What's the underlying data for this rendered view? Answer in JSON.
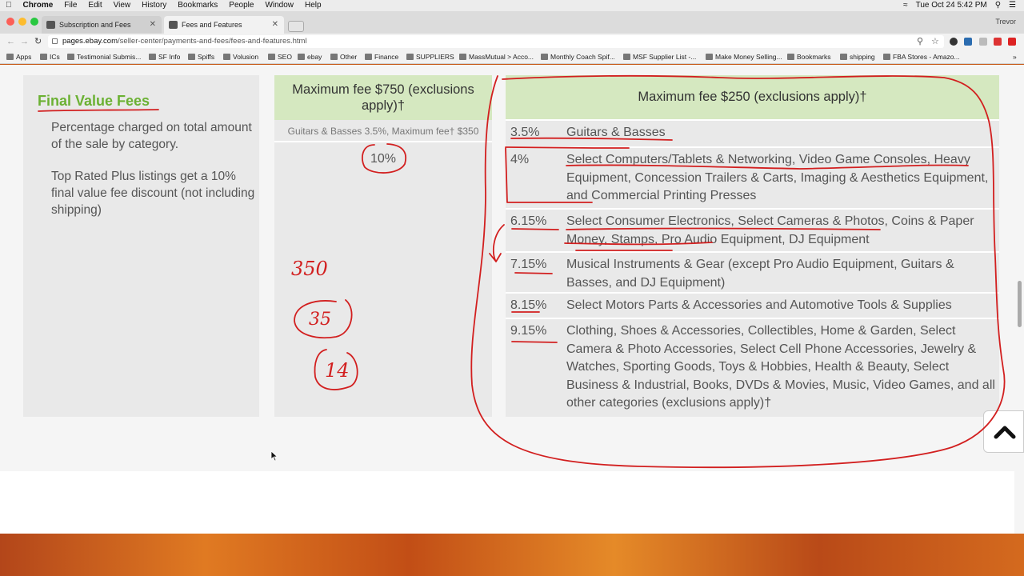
{
  "menubar": {
    "app": "Chrome",
    "items": [
      "File",
      "Edit",
      "View",
      "History",
      "Bookmarks",
      "People",
      "Window",
      "Help"
    ],
    "clock": "Tue Oct 24  5:42 PM"
  },
  "tabs": [
    {
      "title": "Subscription and Fees"
    },
    {
      "title": "Fees and Features"
    }
  ],
  "profile": "Trevor",
  "address": {
    "host": "pages.ebay.com",
    "path": "/seller-center/payments-and-fees/fees-and-features.html"
  },
  "bookmarks": [
    "Apps",
    "ICs",
    "Testimonial Submis...",
    "SF Info",
    "Spiffs",
    "Volusion",
    "SEO",
    "ebay",
    "Other",
    "Finance",
    "SUPPLIERS",
    "MassMutual > Acco...",
    "Monthly Coach Spif...",
    "MSF Supplier List -...",
    "Make Money Selling...",
    "Bookmarks",
    "shipping",
    "FBA Stores - Amazo..."
  ],
  "fees": {
    "title": "Final Value Fees",
    "desc1": "Percentage charged on total amount of the sale by category.",
    "desc2": "Top Rated Plus listings get a 10% final value fee discount (not including shipping)",
    "col2_header": "Maximum fee $750 (exclusions apply)†",
    "col2_sub": "Guitars & Basses 3.5%, Maximum fee† $350",
    "col2_pct": "10%",
    "col3_header": "Maximum fee $250 (exclusions apply)†",
    "rows": [
      {
        "rate": "3.5%",
        "desc": "Guitars & Basses"
      },
      {
        "rate": "4%",
        "desc": "Select Computers/Tablets & Networking, Video Game Consoles, Heavy Equipment, Concession Trailers & Carts, Imaging & Aesthetics Equipment, and Commercial Printing Presses"
      },
      {
        "rate": "6.15%",
        "desc": "Select Consumer Electronics, Select Cameras & Photos, Coins & Paper Money, Stamps, Pro Audio Equipment, DJ Equipment"
      },
      {
        "rate": "7.15%",
        "desc": "Musical Instruments & Gear (except Pro Audio Equipment, Guitars & Basses, and DJ Equipment)"
      },
      {
        "rate": "8.15%",
        "desc": "Select Motors Parts & Accessories and Automotive Tools & Supplies"
      },
      {
        "rate": "9.15%",
        "desc": "Clothing, Shoes & Accessories, Collectibles, Home & Garden, Select Camera & Photo Accessories, Select Cell Phone Accessories, Jewelry & Watches, Sporting Goods, Toys & Hobbies, Health & Beauty, Select Business & Industrial, Books, DVDs & Movies, Music, Video Games, and all other categories (exclusions apply)†"
      }
    ]
  },
  "annotations": {
    "n350": "350",
    "n35": "35",
    "n14": "14",
    "ink_color": "#d21f1f"
  }
}
